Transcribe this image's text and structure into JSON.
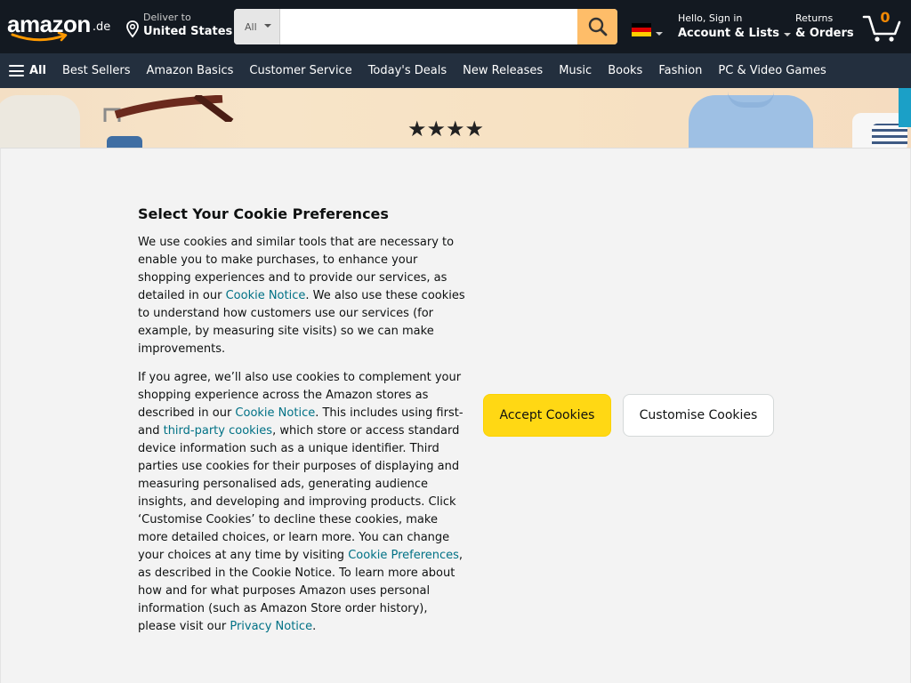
{
  "header": {
    "logo_text": "amazon",
    "logo_tld": ".de",
    "deliver_label": "Deliver to",
    "deliver_location": "United States",
    "search": {
      "department": "All",
      "placeholder": ""
    },
    "account_greeting": "Hello, Sign in",
    "account_label": "Account & Lists",
    "returns_label": "Returns",
    "orders_label": "& Orders",
    "cart_count": "0",
    "flag_colors": [
      "#000000",
      "#dd0000",
      "#ffce00"
    ]
  },
  "nav": {
    "all_label": "All",
    "items": [
      "Best Sellers",
      "Amazon Basics",
      "Customer Service",
      "Today's Deals",
      "New Releases",
      "Music",
      "Books",
      "Fashion",
      "PC & Video Games"
    ]
  },
  "banner": {
    "stars": "★★★★"
  },
  "cookie": {
    "title": "Select Your Cookie Preferences",
    "p1_a": "We use cookies and similar tools that are necessary to enable you to make purchases, to enhance your shopping experiences and to provide our services, as detailed in our ",
    "p1_link": "Cookie Notice",
    "p1_b": ". We also use these cookies to understand how customers use our services (for example, by measuring site visits) so we can make improvements.",
    "p2_a": "If you agree, we’ll also use cookies to complement your shopping experience across the Amazon stores as described in our ",
    "p2_link1": "Cookie Notice",
    "p2_b": ". This includes using first- and ",
    "p2_link2": "third-party cookies",
    "p2_c": ", which store or access standard device information such as a unique identifier. Third parties use cookies for their purposes of displaying and measuring personalised ads, generating audience insights, and developing and improving products. Click ‘Customise Cookies’ to decline these cookies, make more detailed choices, or learn more. You can change your choices at any time by visiting ",
    "p2_link3": "Cookie Preferences",
    "p2_d": ", as described in the Cookie Notice. To learn more about how and for what purposes Amazon uses personal information (such as Amazon Store order history), please visit our ",
    "p2_link4": "Privacy Notice",
    "p2_e": ".",
    "accept_label": "Accept Cookies",
    "customise_label": "Customise Cookies"
  },
  "colors": {
    "header_bg": "#131921",
    "nav_bg": "#232f3e",
    "search_button": "#febd69",
    "accept_button": "#ffd814",
    "link": "#007185",
    "cart_count": "#f08804"
  }
}
